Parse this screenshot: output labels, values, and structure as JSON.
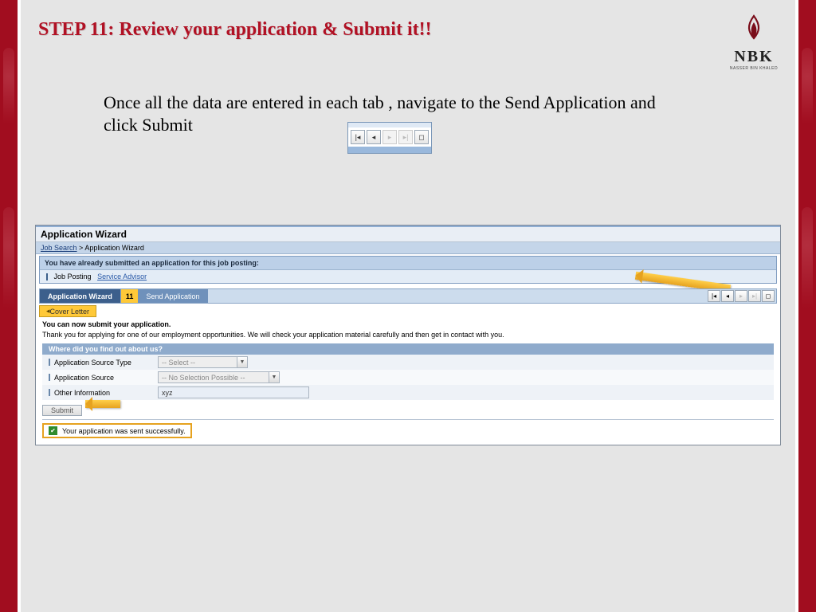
{
  "header": {
    "title": "STEP 11: Review your application & Submit it!!",
    "logo_text": "NBK",
    "logo_sub": "NASSER BIN KHALED"
  },
  "intro": "Once all the data are entered in each tab , navigate to the Send Application and click Submit",
  "wizard": {
    "title": "Application Wizard",
    "breadcrumb_link": "Job Search",
    "breadcrumb_sep": ">",
    "breadcrumb_current": "Application Wizard",
    "already_submitted_hdr": "You have already submitted an application for this job posting:",
    "job_posting_label": "Job Posting",
    "job_posting_link": "Service Advisor",
    "wiz_tab": "Application Wizard",
    "step_num": "11",
    "step_name": "Send Application",
    "cover_tab": "Cover Letter",
    "submit_now_bold": "You can now submit your application.",
    "submit_now_text": "Thank you for applying for one of our employment opportunities. We will check your application material carefully and then get in contact with you.",
    "find_hdr": "Where did you find out about us?",
    "rows": {
      "src_type_label": "Application Source Type",
      "src_type_value": "-- Select --",
      "src_label": "Application Source",
      "src_value": "-- No Selection Possible --",
      "other_label": "Other Information",
      "other_value": "xyz"
    },
    "submit_btn": "Submit",
    "success_msg": "Your application was sent successfully."
  }
}
